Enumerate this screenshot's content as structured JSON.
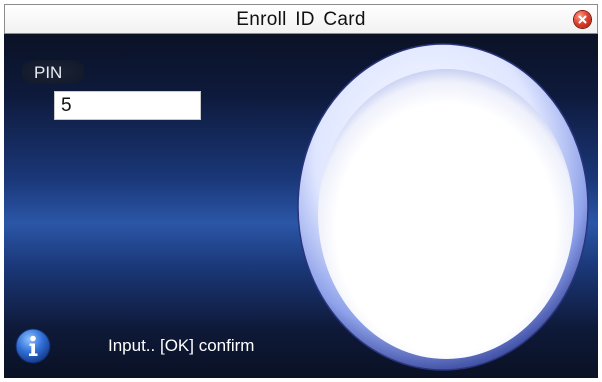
{
  "window": {
    "title": "Enroll  ID Card",
    "close_icon": "close-icon"
  },
  "form": {
    "pin_label": "PIN",
    "pin_value": "5"
  },
  "card_reader": {
    "icon": "card-reader-circle"
  },
  "status": {
    "icon": "info-icon",
    "text": "Input.. [OK] confirm"
  },
  "colors": {
    "title_bar": "#f4f4f4",
    "background_dark": "#0b1226",
    "background_mid": "#2b56a7",
    "close_button": "#e0442e",
    "info_icon": "#2f6fd6"
  }
}
